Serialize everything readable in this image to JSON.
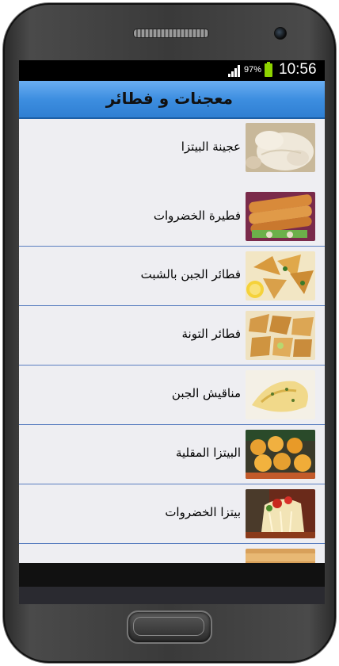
{
  "status": {
    "battery_percent": "97%",
    "time": "10:56"
  },
  "app": {
    "title": "معجنات و فطائر"
  },
  "items": [
    {
      "label": "عجينة البيتزا",
      "thumb": "pizza-dough"
    },
    {
      "label": "فطيرة الخضروات",
      "thumb": "vegetable-pie"
    },
    {
      "label": "فطائر الجبن بالشبت",
      "thumb": "cheese-dill-pastries"
    },
    {
      "label": "فطائر التونة",
      "thumb": "tuna-pastries"
    },
    {
      "label": "مناقيش الجبن",
      "thumb": "cheese-manakish"
    },
    {
      "label": "البيتزا المقلية",
      "thumb": "fried-pizza"
    },
    {
      "label": "بيتزا الخضروات",
      "thumb": "vegetable-pizza"
    },
    {
      "label": "",
      "thumb": "pastry-partial"
    }
  ]
}
